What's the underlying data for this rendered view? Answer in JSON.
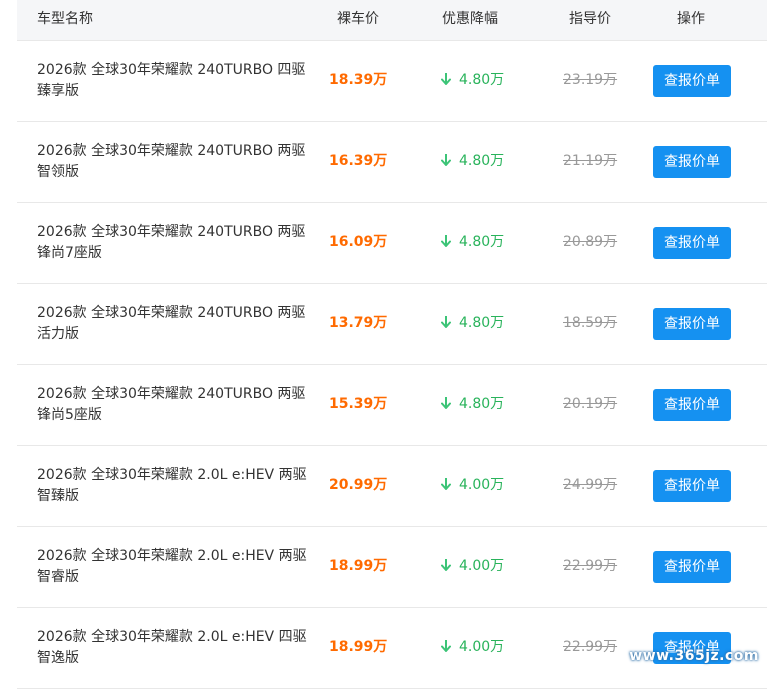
{
  "header": {
    "model": "车型名称",
    "bare_price": "裸车价",
    "discount": "优惠降幅",
    "guide_price": "指导价",
    "action": "操作"
  },
  "rows": [
    {
      "name": "2026款 全球30年荣耀款 240TURBO 四驱臻享版",
      "price": "18.39万",
      "discount": "4.80万",
      "guide": "23.19万",
      "button": "查报价单"
    },
    {
      "name": "2026款 全球30年荣耀款 240TURBO 两驱智领版",
      "price": "16.39万",
      "discount": "4.80万",
      "guide": "21.19万",
      "button": "查报价单"
    },
    {
      "name": "2026款 全球30年荣耀款 240TURBO 两驱锋尚7座版",
      "price": "16.09万",
      "discount": "4.80万",
      "guide": "20.89万",
      "button": "查报价单"
    },
    {
      "name": "2026款 全球30年荣耀款 240TURBO 两驱活力版",
      "price": "13.79万",
      "discount": "4.80万",
      "guide": "18.59万",
      "button": "查报价单"
    },
    {
      "name": "2026款 全球30年荣耀款 240TURBO 两驱锋尚5座版",
      "price": "15.39万",
      "discount": "4.80万",
      "guide": "20.19万",
      "button": "查报价单"
    },
    {
      "name": "2026款 全球30年荣耀款 2.0L e:HEV 两驱智臻版",
      "price": "20.99万",
      "discount": "4.00万",
      "guide": "24.99万",
      "button": "查报价单"
    },
    {
      "name": "2026款 全球30年荣耀款 2.0L e:HEV 两驱智睿版",
      "price": "18.99万",
      "discount": "4.00万",
      "guide": "22.99万",
      "button": "查报价单"
    },
    {
      "name": "2026款 全球30年荣耀款 2.0L e:HEV 四驱智逸版",
      "price": "18.99万",
      "discount": "4.00万",
      "guide": "22.99万",
      "button": "查报价单"
    }
  ],
  "watermark": "www.365jz.com",
  "colors": {
    "price": "#ff6a00",
    "discount": "#29b35b",
    "button": "#1591f1",
    "guide": "#999999"
  },
  "icons": {
    "discount_arrow": "arrow-down-icon"
  }
}
